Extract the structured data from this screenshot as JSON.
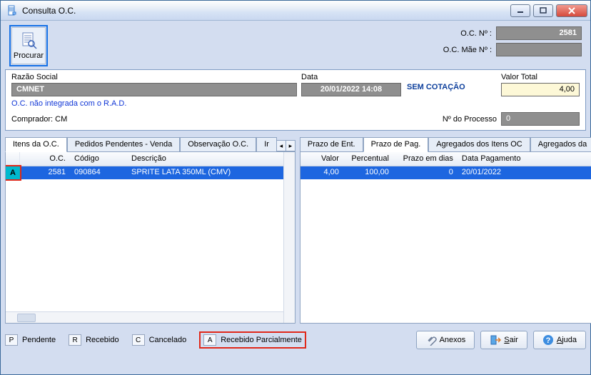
{
  "window": {
    "title": "Consulta O.C."
  },
  "toolbar": {
    "procurar_label": "Procurar"
  },
  "oc": {
    "oc_no_label": "O.C. Nº :",
    "oc_no_value": "2581",
    "oc_mae_label": "O.C. Mãe Nº :",
    "oc_mae_value": ""
  },
  "header": {
    "razao_label": "Razão Social",
    "razao_value": "CMNET",
    "data_label": "Data",
    "data_value": "20/01/2022 14:08",
    "sem_cotacao": "SEM COTAÇÃO",
    "valor_label": "Valor Total",
    "valor_value": "4,00",
    "rad_note": "O.C. não integrada com o R.A.D.",
    "comprador_label": "Comprador: CM",
    "n_processo_label": "Nº do Processo",
    "n_processo_value": "0"
  },
  "ltabs": {
    "items": [
      "Itens da O.C.",
      "Pedidos Pendentes - Venda",
      "Observação O.C.",
      "Ir"
    ],
    "active": 0,
    "headers": {
      "status": "",
      "oc": "O.C.",
      "codigo": "Código",
      "desc": "Descrição"
    },
    "rows": [
      {
        "status": "A",
        "oc": "2581",
        "codigo": "090864",
        "desc": "SPRITE LATA 350ML (CMV)"
      }
    ]
  },
  "rtabs": {
    "items": [
      "Prazo de Ent.",
      "Prazo de Pag.",
      "Agregados dos Itens OC",
      "Agregados da"
    ],
    "active": 1,
    "headers": {
      "valor": "Valor",
      "pct": "Percentual",
      "dias": "Prazo em dias",
      "data": "Data Pagamento"
    },
    "rows": [
      {
        "valor": "4,00",
        "pct": "100,00",
        "dias": "0",
        "data": "20/01/2022"
      }
    ]
  },
  "legend": {
    "P": "Pendente",
    "R": "Recebido",
    "C": "Cancelado",
    "A": "Recebido Parcialmente"
  },
  "buttons": {
    "anexos": "Anexos",
    "sair_prefix": "S",
    "sair_rest": "air",
    "ajuda_prefix": "A",
    "ajuda_rest": "juda"
  }
}
